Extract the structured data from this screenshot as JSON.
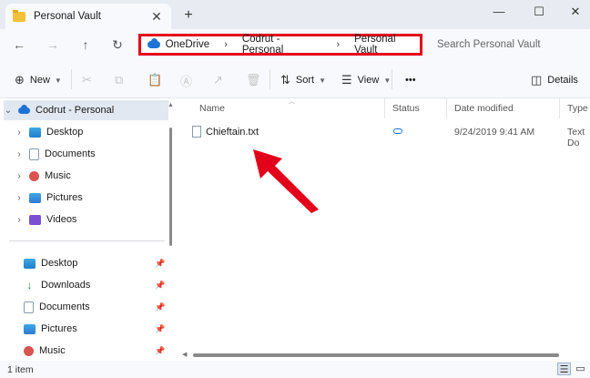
{
  "window": {
    "tab_title": "Personal Vault",
    "tab_close": "✕",
    "new_tab": "+",
    "minimize": "—",
    "maximize": "☐",
    "close": "✕"
  },
  "address": {
    "crumbs": [
      "OneDrive",
      "Codrut - Personal",
      "Personal Vault"
    ],
    "separator": "›",
    "search_placeholder": "Search Personal Vault"
  },
  "toolbar": {
    "new_label": "New",
    "sort_label": "Sort",
    "view_label": "View",
    "more_label": "•••",
    "details_label": "Details"
  },
  "navpane": {
    "tree": [
      {
        "label": "Codrut - Personal",
        "icon": "cloud-icon"
      },
      {
        "label": "Desktop",
        "icon": "desktop-icon"
      },
      {
        "label": "Documents",
        "icon": "documents-icon"
      },
      {
        "label": "Music",
        "icon": "music-icon"
      },
      {
        "label": "Pictures",
        "icon": "pictures-icon"
      },
      {
        "label": "Videos",
        "icon": "videos-icon"
      }
    ],
    "quick_access": [
      {
        "label": "Desktop",
        "icon": "desktop-icon"
      },
      {
        "label": "Downloads",
        "icon": "downloads-icon"
      },
      {
        "label": "Documents",
        "icon": "documents-icon"
      },
      {
        "label": "Pictures",
        "icon": "pictures-icon"
      },
      {
        "label": "Music",
        "icon": "music-icon"
      }
    ]
  },
  "columns": {
    "name": "Name",
    "status": "Status",
    "date_modified": "Date modified",
    "type": "Type"
  },
  "files": [
    {
      "name": "Chieftain.txt",
      "date_modified": "9/24/2019 9:41 AM",
      "type": "Text Do"
    }
  ],
  "statusbar": {
    "item_count": "1 item"
  },
  "colors": {
    "highlight": "#e3001b",
    "accent": "#1e73d6"
  }
}
